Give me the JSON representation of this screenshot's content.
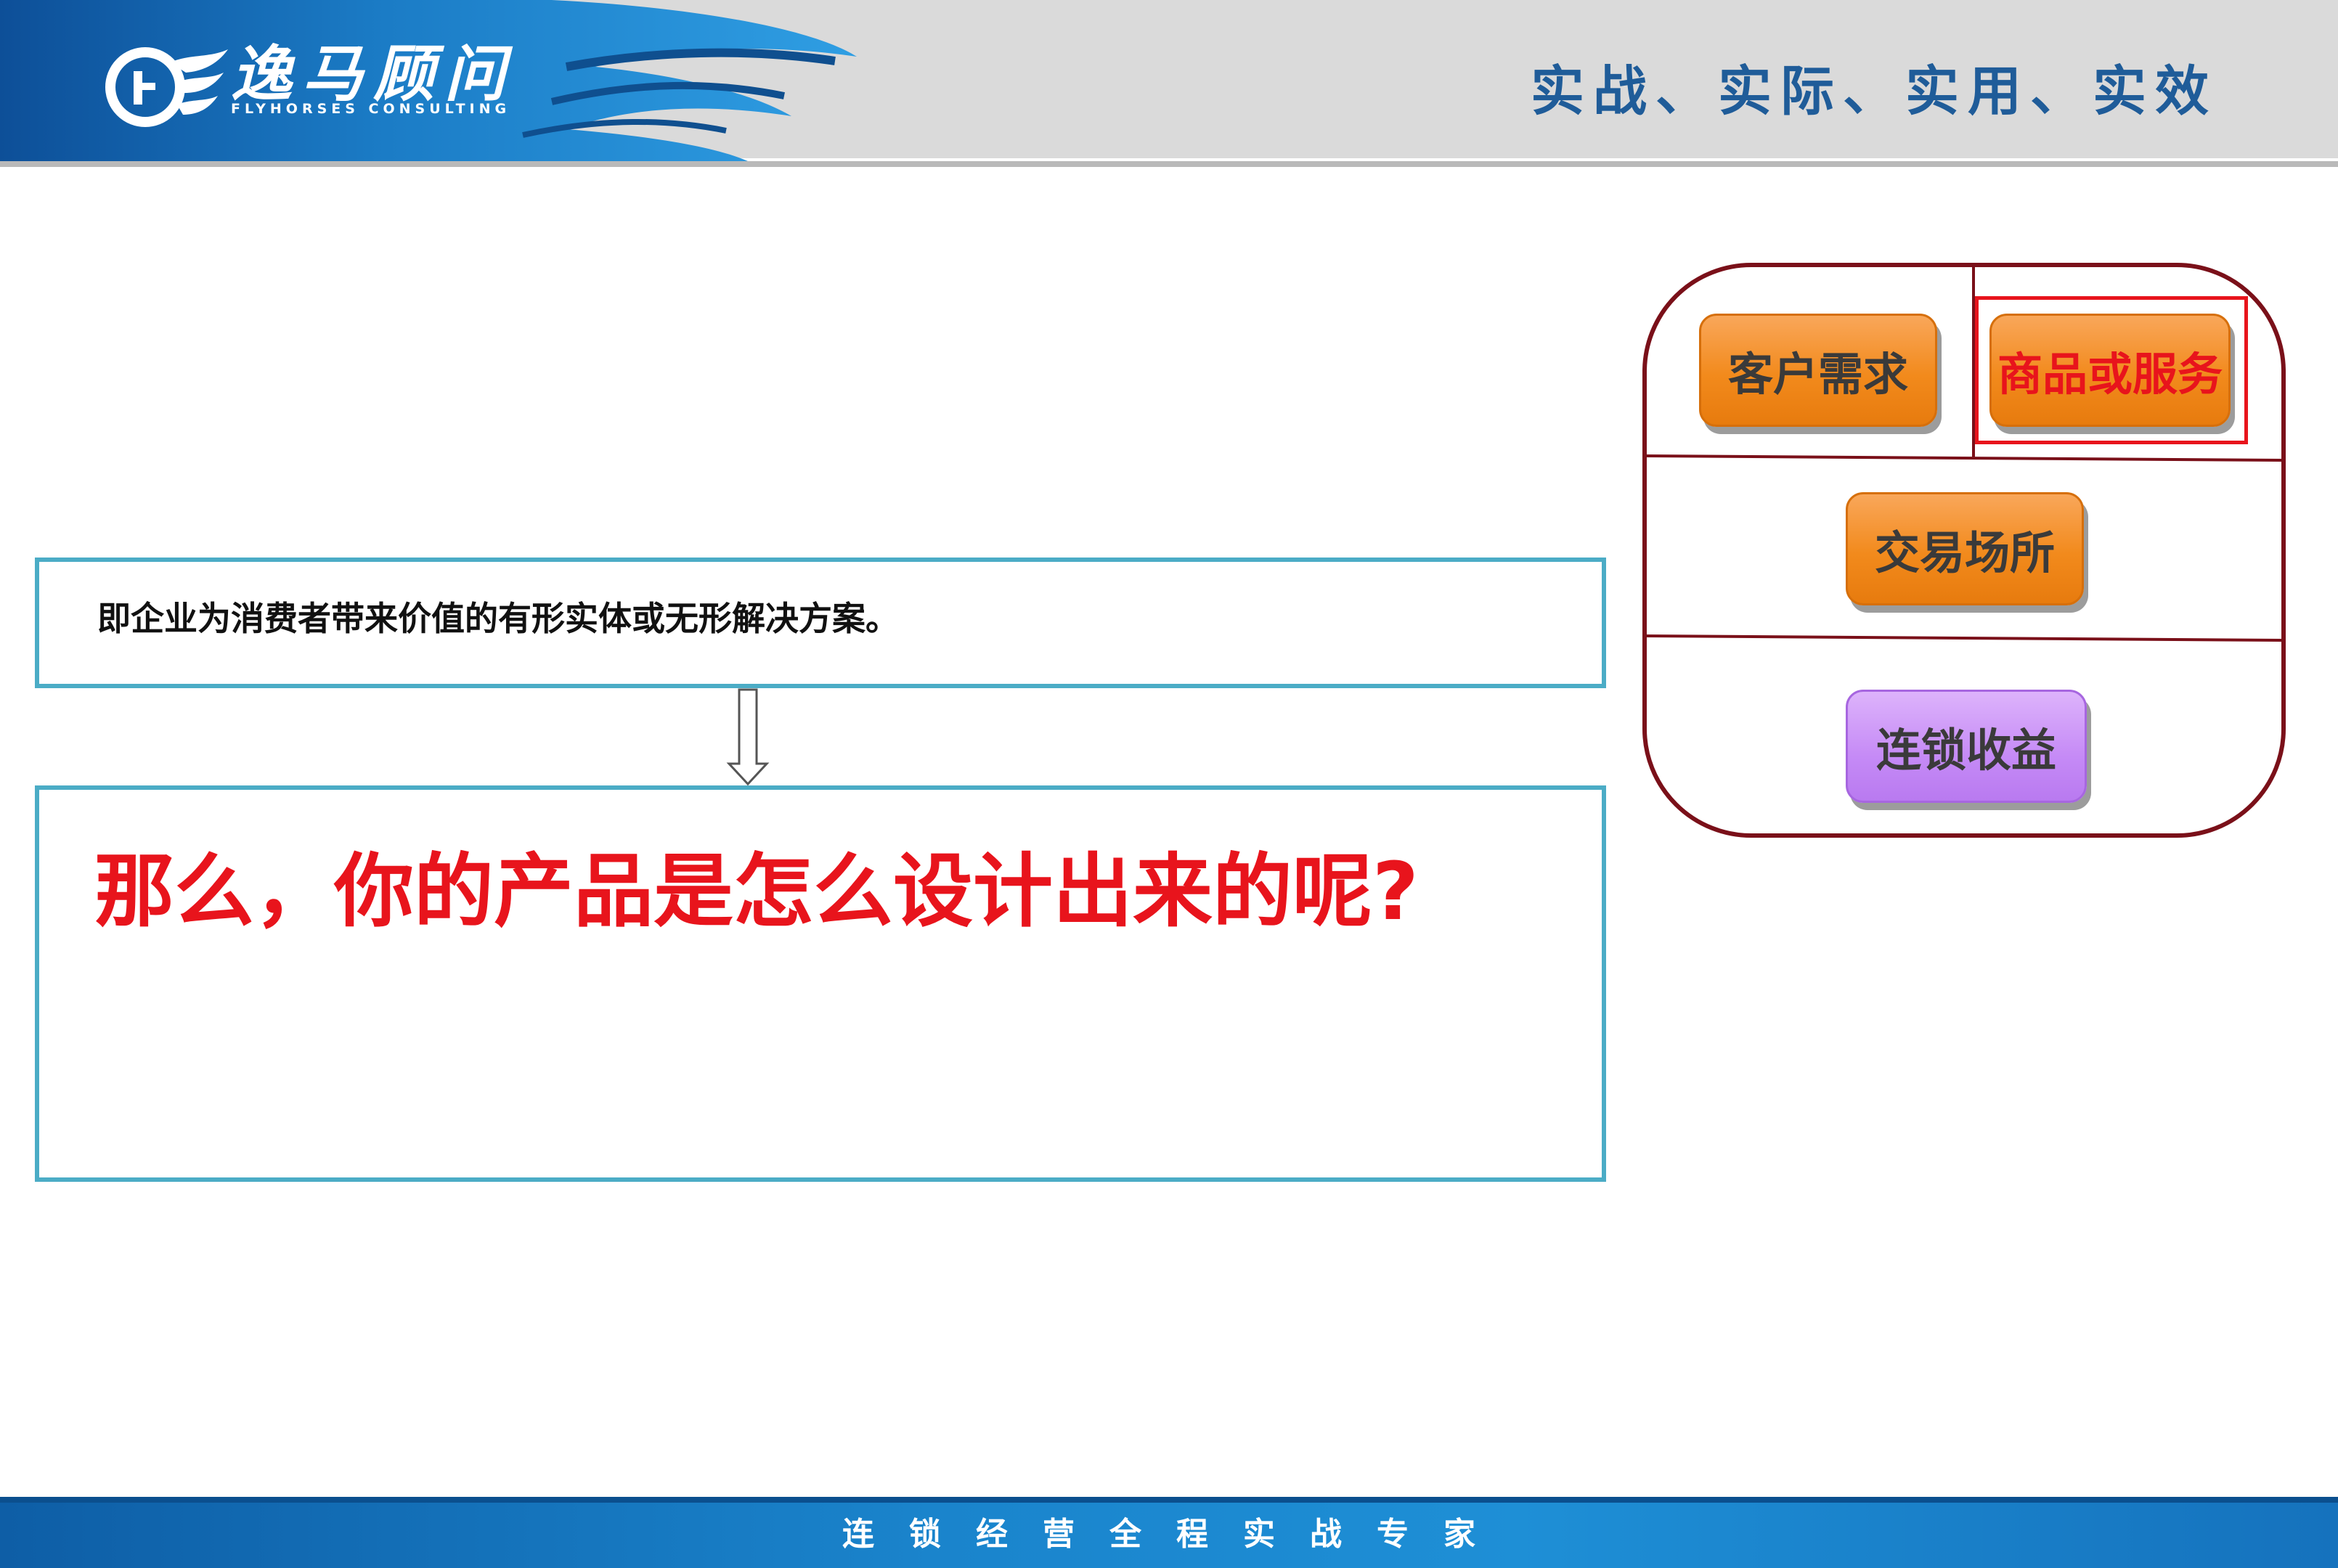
{
  "header": {
    "brand_name": "逸马顾问",
    "brand_sub": "FLYHORSES CONSULTING",
    "slogan": "实战、实际、实用、实效"
  },
  "definition": {
    "text": "即企业为消费者带来价值的有形实体或无形解决方案。"
  },
  "question": {
    "text": "那么，你的产品是怎么设计出来的呢?"
  },
  "model": {
    "items": [
      {
        "label": "客户需求"
      },
      {
        "label": "商品或服务",
        "highlighted": true
      },
      {
        "label": "交易场所"
      },
      {
        "label": "连锁收益"
      }
    ]
  },
  "footer": {
    "text": "连锁经营全程实战专家"
  },
  "colors": {
    "accent_blue": "#4bacc6",
    "highlight_red": "#e8141c",
    "panel_border": "#7a1019",
    "pill_orange": "#f28a1c",
    "pill_purple": "#c58af6"
  }
}
